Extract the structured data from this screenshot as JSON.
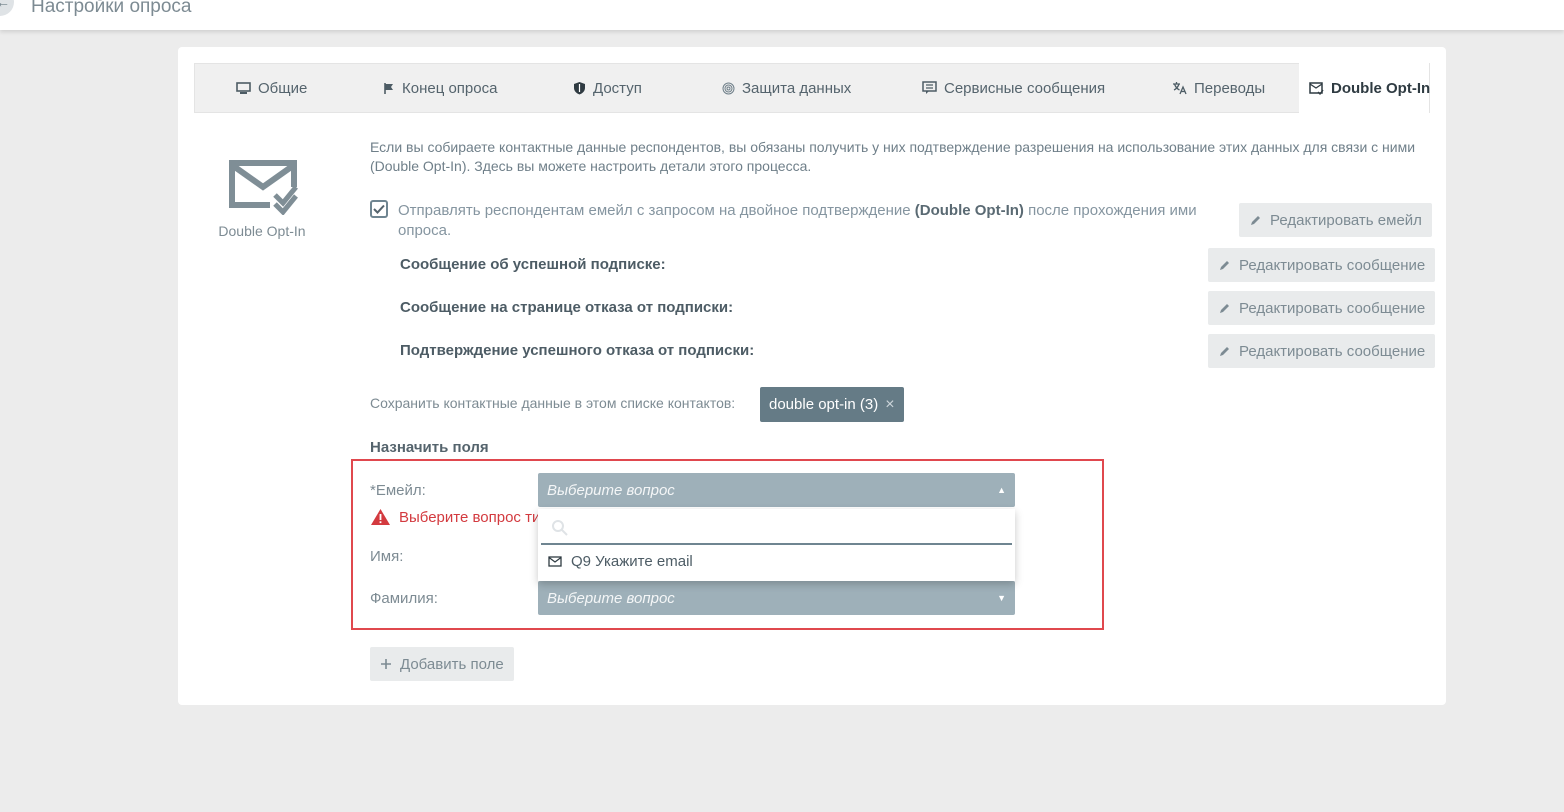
{
  "header": {
    "title": "Настройки опроса",
    "back_icon": "arrow-left-icon"
  },
  "tabs": [
    {
      "label": "Общие",
      "icon": "monitor-icon",
      "active": false
    },
    {
      "label": "Конец опроса",
      "icon": "flag-icon",
      "active": false
    },
    {
      "label": "Доступ",
      "icon": "shield-icon",
      "active": false
    },
    {
      "label": "Защита данных",
      "icon": "fingerprint-icon",
      "active": false
    },
    {
      "label": "Сервисные сообщения",
      "icon": "messages-icon",
      "active": false
    },
    {
      "label": "Переводы",
      "icon": "translate-icon",
      "active": false
    },
    {
      "label": "Double Opt-In",
      "icon": "mail-check-icon",
      "active": true
    }
  ],
  "side": {
    "label": "Double Opt-In",
    "icon": "mail-check-icon"
  },
  "intro": "Если вы собираете контактные данные респондентов, вы обязаны получить у них подтверждение разрешения на использование этих данных для связи с ними (Double Opt-In). Здесь вы можете настроить детали этого процесса.",
  "send_option": {
    "checked": true,
    "text_before": "Отправлять респондентам емейл с запросом на двойное подтверждение ",
    "text_bold": "(Double Opt-In)",
    "text_after": " после прохождения ими опроса."
  },
  "edit_email_button": "Редактировать емейл",
  "messages": [
    {
      "label": "Сообщение об успешной подписке:",
      "button": "Редактировать сообщение"
    },
    {
      "label": "Сообщение на странице отказа от подписки:",
      "button": "Редактировать сообщение"
    },
    {
      "label": "Подтверждение успешного отказа от подписки:",
      "button": "Редактировать сообщение"
    }
  ],
  "contact_list": {
    "label": "Сохранить контактные данные в этом списке контактов:",
    "tag": "double opt-in (3)",
    "remove": "×"
  },
  "assign_fields": {
    "title": "Назначить поля",
    "email_label": "*Емейл:",
    "email_placeholder": "Выберите вопрос",
    "error": "Выберите вопрос тип",
    "name_label": "Имя:",
    "surname_label": "Фамилия:",
    "surname_placeholder": "Выберите вопрос"
  },
  "dropdown": {
    "search_placeholder": "",
    "option": "Q9 Укажите email"
  },
  "add_field_button": "Добавить поле",
  "colors": {
    "accent": "#657b86",
    "select": "#9eb0b9",
    "error": "#d33a3f",
    "highlight": "#e0484e"
  }
}
